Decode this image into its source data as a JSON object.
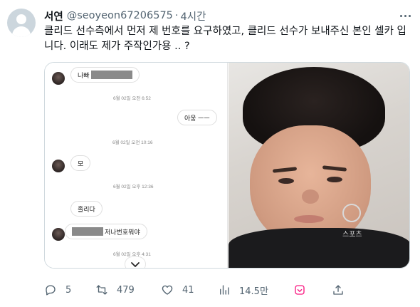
{
  "author": {
    "name": "서연",
    "handle": "@seoyeon67206575",
    "separator": "·",
    "time": "4시간"
  },
  "tweet": {
    "text": "클리드 선수측에서 먼저 제 번호를 요구하였고, 클리드 선수가 보내주신 본인 셀카 입니다. 이래도 제가 주작인가용 .. ?"
  },
  "chat": {
    "messages": [
      {
        "side": "them",
        "prefix": "나빠"
      },
      {
        "side": "me",
        "text": "아웅 ㅡㅡ"
      },
      {
        "side": "them",
        "text": "모"
      },
      {
        "side": "them",
        "text": "졸리다"
      },
      {
        "side": "them",
        "suffix": "저나번호뭐야"
      }
    ],
    "timestamps": [
      "6월 02일 오전 6:52",
      "6월 02일 오전 10:16",
      "6월 02일 오후 12:36",
      "6월 02일 오후 4:31"
    ]
  },
  "photo": {
    "shirt_text": "스포츠"
  },
  "actions": {
    "reply_count": "5",
    "retweet_count": "479",
    "like_count": "41",
    "view_count": "14.5만"
  },
  "colors": {
    "text_primary": "#0f1419",
    "text_secondary": "#536471",
    "border": "#cfd9de",
    "pink_icon": "#f91880"
  },
  "icons": [
    "avatar-placeholder",
    "more-icon",
    "reply-icon",
    "retweet-icon",
    "like-icon",
    "views-icon",
    "bookmark-icon",
    "share-icon",
    "chevron-down-icon"
  ]
}
